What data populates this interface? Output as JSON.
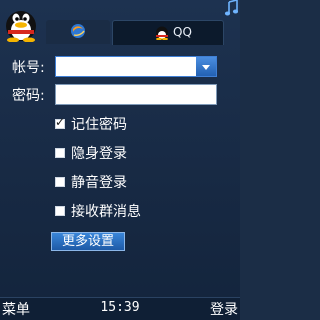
{
  "header": {
    "tabs": [
      {
        "name": "browser",
        "label": ""
      },
      {
        "name": "qq",
        "label": "QQ"
      }
    ]
  },
  "form": {
    "account_label": "帐号:",
    "account_value": "",
    "password_label": "密码:",
    "password_value": ""
  },
  "options": [
    {
      "label": "记住密码",
      "checked": true
    },
    {
      "label": "隐身登录",
      "checked": false
    },
    {
      "label": "静音登录",
      "checked": false
    },
    {
      "label": "接收群消息",
      "checked": false
    }
  ],
  "more_settings_label": "更多设置",
  "bottom": {
    "left_softkey": "菜单",
    "time": "15:39",
    "right_softkey": "登录"
  },
  "colors": {
    "background": "#1b2d46",
    "accent": "#2f73c9",
    "bottom_bar": "#0f1f35"
  },
  "icons": [
    "qq-penguin-avatar-icon",
    "music-note-icon",
    "browser-globe-icon",
    "qq-logo-icon",
    "dropdown-arrow-icon"
  ]
}
